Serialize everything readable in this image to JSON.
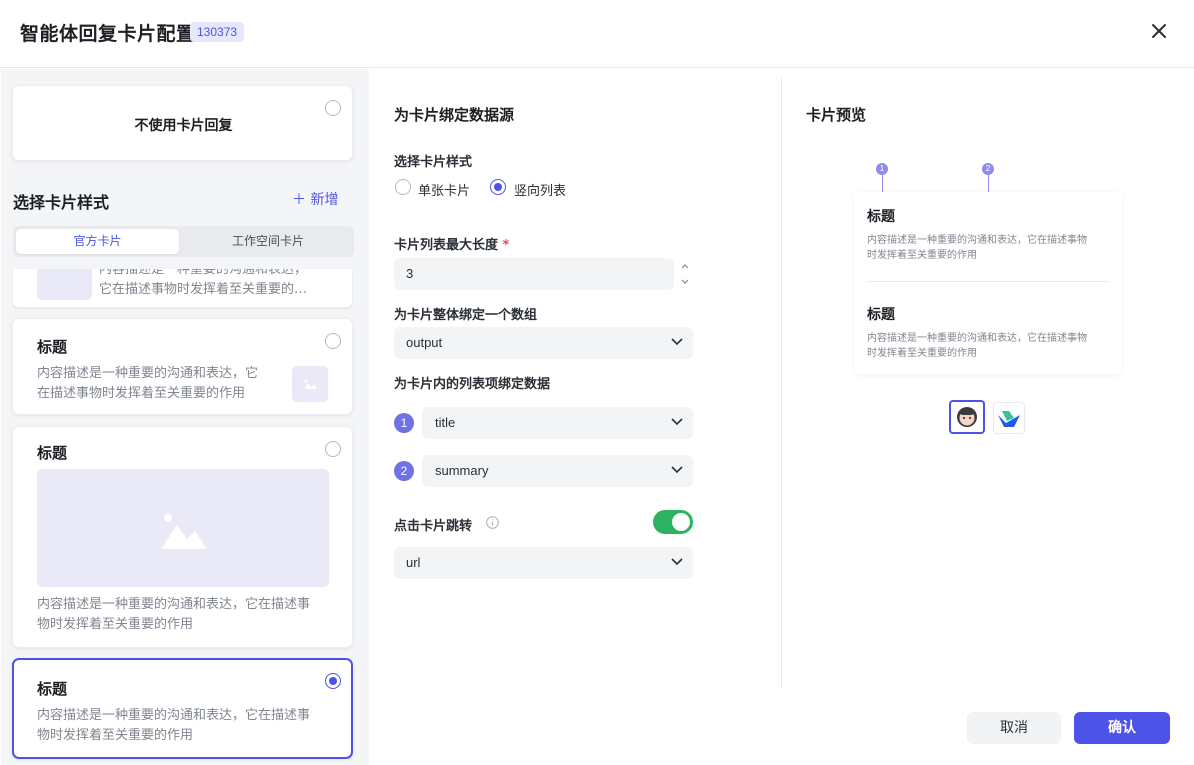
{
  "header": {
    "title": "智能体回复卡片配置",
    "badge": "130373",
    "close_icon": "close-icon"
  },
  "left": {
    "no_card": {
      "label": "不使用卡片回复"
    },
    "section_title": "选择卡片样式",
    "add_new": "＋ 新增",
    "tabs": [
      {
        "label": "官方卡片",
        "active": true
      },
      {
        "label": "工作空间卡片",
        "active": false
      }
    ],
    "cards": [
      {
        "desc_line1": "内容描述是一种重要的沟通和表达，",
        "desc_line2": "它在描述事物时发挥着至关重要的…"
      },
      {
        "title": "标题",
        "desc_line1": "内容描述是一种重要的沟通和表达，它",
        "desc_line2": "在描述事物时发挥着至关重要的作用"
      },
      {
        "title": "标题",
        "desc_line1": "内容描述是一种重要的沟通和表达，它在描述事",
        "desc_line2": "物时发挥着至关重要的作用"
      },
      {
        "title": "标题",
        "desc_line1": "内容描述是一种重要的沟通和表达，它在描述事",
        "desc_line2": "物时发挥着至关重要的作用",
        "selected": true
      }
    ]
  },
  "middle": {
    "heading": "为卡片绑定数据源",
    "style_label": "选择卡片样式",
    "style_options": [
      {
        "label": "单张卡片",
        "checked": false
      },
      {
        "label": "竖向列表",
        "checked": true
      }
    ],
    "max_len_label": "卡片列表最大长度",
    "required_mark": "*",
    "max_len_value": "3",
    "array_label": "为卡片整体绑定一个数组",
    "array_value": "output",
    "item_label": "为卡片内的列表项绑定数据",
    "items": [
      {
        "num": "1",
        "value": "title"
      },
      {
        "num": "2",
        "value": "summary"
      }
    ],
    "jump_label": "点击卡片跳转",
    "jump_enabled": true,
    "jump_value": "url"
  },
  "right": {
    "heading": "卡片预览",
    "pins": [
      "1",
      "2"
    ],
    "preview_items": [
      {
        "title": "标题",
        "desc_line1": "内容描述是一种重要的沟通和表达，它在描述事物",
        "desc_line2": "时发挥着至关重要的作用"
      },
      {
        "title": "标题",
        "desc_line1": "内容描述是一种重要的沟通和表达，它在描述事物",
        "desc_line2": "时发挥着至关重要的作用"
      }
    ]
  },
  "footer": {
    "cancel": "取消",
    "confirm": "确认"
  },
  "colors": {
    "accent": "#4d53e8",
    "toggle_on": "#2db35f",
    "pin": "#8f8cf0"
  }
}
